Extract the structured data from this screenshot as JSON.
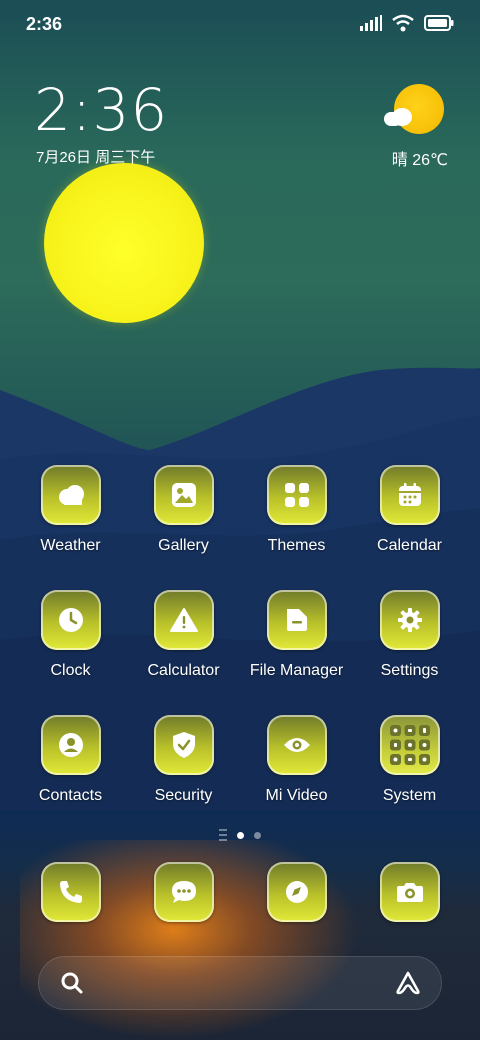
{
  "statusbar": {
    "time": "2:36",
    "icons": [
      "signal-icon",
      "wifi-icon",
      "battery-icon"
    ]
  },
  "clock_widget": {
    "time": "2:36",
    "date": "7月26日 周三下午"
  },
  "weather_widget": {
    "text": "晴 26℃",
    "icon": "sun-cloud-icon"
  },
  "apps": [
    {
      "label": "Weather",
      "icon": "weather-icon"
    },
    {
      "label": "Gallery",
      "icon": "gallery-icon"
    },
    {
      "label": "Themes",
      "icon": "themes-icon"
    },
    {
      "label": "Calendar",
      "icon": "calendar-icon"
    },
    {
      "label": "Clock",
      "icon": "clock-icon"
    },
    {
      "label": "Calculator",
      "icon": "calculator-icon"
    },
    {
      "label": "File Manager",
      "icon": "file-manager-icon"
    },
    {
      "label": "Settings",
      "icon": "settings-icon"
    },
    {
      "label": "Contacts",
      "icon": "contacts-icon"
    },
    {
      "label": "Security",
      "icon": "security-icon"
    },
    {
      "label": "Mi Video",
      "icon": "mi-video-icon"
    },
    {
      "label": "System",
      "icon": "system-folder-icon"
    }
  ],
  "dock": [
    {
      "icon": "phone-icon"
    },
    {
      "icon": "messages-icon"
    },
    {
      "icon": "browser-compass-icon"
    },
    {
      "icon": "camera-icon"
    }
  ],
  "page_indicator": {
    "pages": 2,
    "active": 1
  },
  "searchbar": {
    "left_icon": "search-icon",
    "right_icon": "assistant-icon"
  },
  "colors": {
    "sun": "#f7f21a",
    "icon_gradient_top": "#6f7a2a",
    "icon_gradient_bottom": "#e2ea38",
    "sky": "#2a6a5a",
    "sea": "#0e2b55"
  }
}
